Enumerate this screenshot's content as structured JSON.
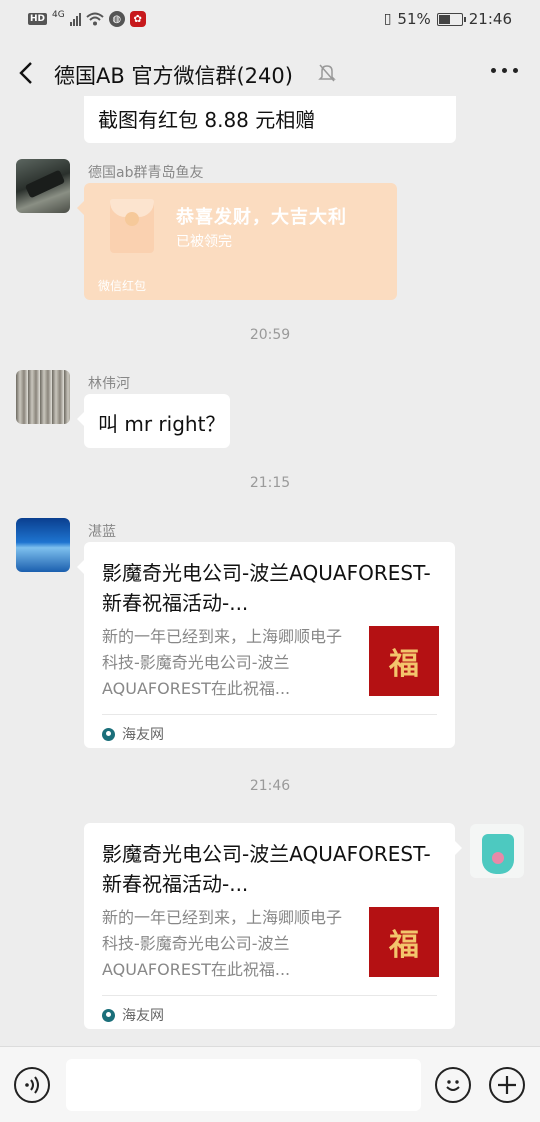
{
  "status_bar": {
    "network": "4G",
    "battery": "51%",
    "battery_level": 0.51,
    "time": "21:46"
  },
  "header": {
    "title": "德国AB  官方微信群(240)"
  },
  "messages": {
    "partial_text": "截图有红包 8.88 元相赠",
    "msg1": {
      "nickname": "德国ab群青岛鱼友",
      "redpacket_title": "恭喜发财，大吉大利",
      "redpacket_status": "已被领完",
      "redpacket_footer": "微信红包"
    },
    "time1": "20:59",
    "msg2": {
      "nickname": "林伟河",
      "text": "叫 mr right？"
    },
    "time2": "21:15",
    "msg3": {
      "nickname": "湛蓝",
      "link_title": "影魔奇光电公司-波兰AQUAFOREST-新春祝福活动-...",
      "link_desc": "新的一年已经到来，上海卿顺电子科技-影魔奇光电公司-波兰AQUAFOREST在此祝福...",
      "thumb_char": "福",
      "source": "海友网"
    },
    "time3": "21:46",
    "msg4": {
      "link_title": "影魔奇光电公司-波兰AQUAFOREST-新春祝福活动-...",
      "link_desc": "新的一年已经到来，上海卿顺电子科技-影魔奇光电公司-波兰AQUAFOREST在此祝福...",
      "thumb_char": "福",
      "source": "海友网"
    }
  },
  "input_bar": {
    "value": ""
  }
}
